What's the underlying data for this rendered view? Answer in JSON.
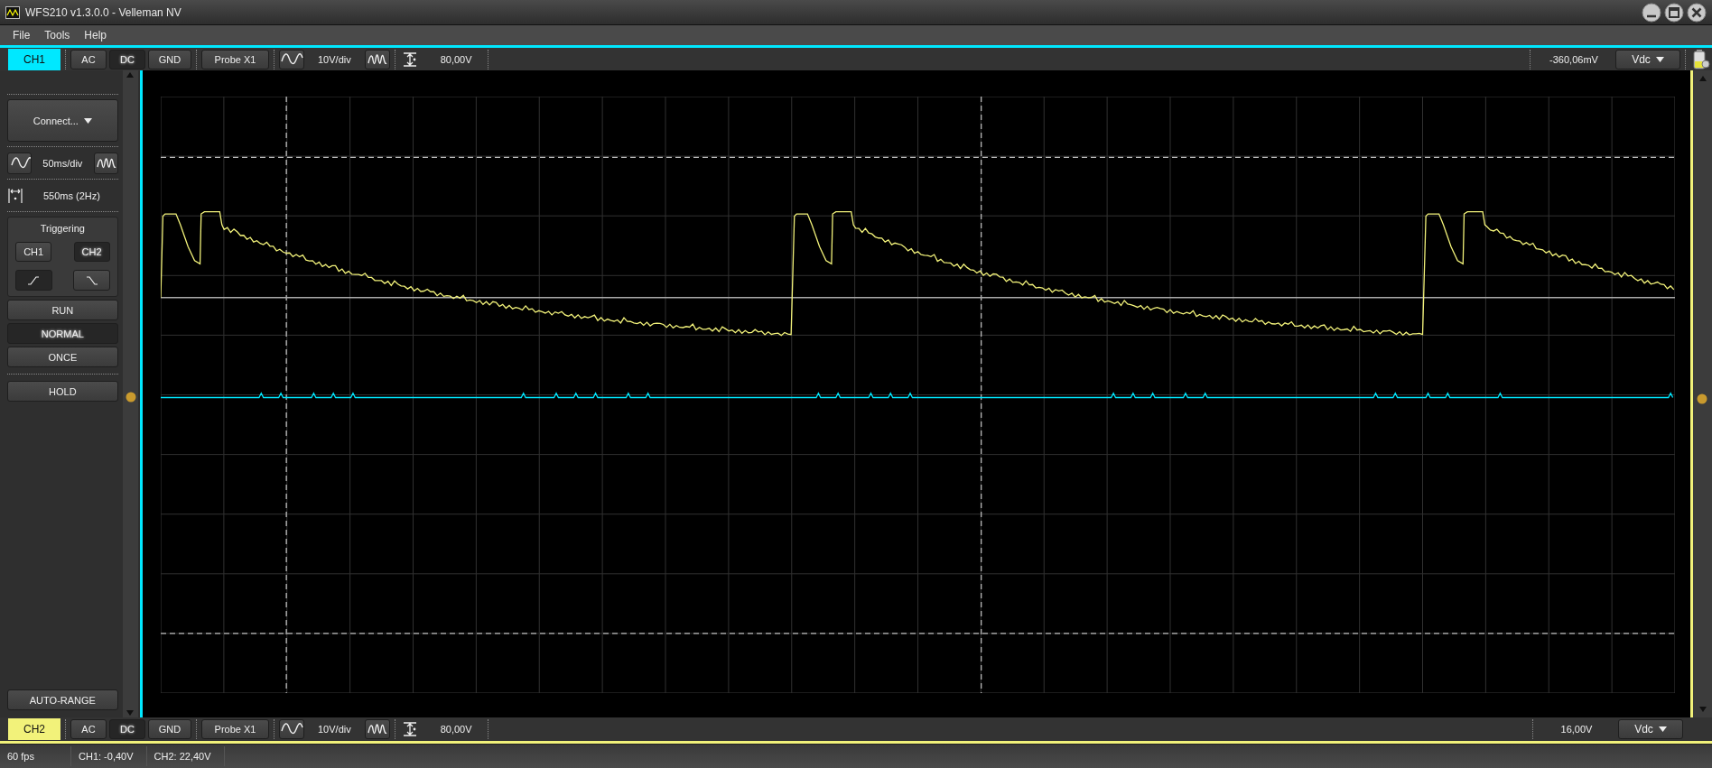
{
  "window": {
    "title": "WFS210 v1.3.0.0 - Velleman NV"
  },
  "menu": [
    "File",
    "Tools",
    "Help"
  ],
  "channels": [
    {
      "label": "CH1",
      "color": "#00e8ff",
      "coupling": [
        {
          "label": "AC",
          "selected": false
        },
        {
          "label": "DC",
          "selected": true
        },
        {
          "label": "GND",
          "selected": false
        }
      ],
      "probe": "Probe X1",
      "volts_per_div": "10V/div",
      "offset": "80,00V",
      "reading": "-360,06mV",
      "unit": "Vdc"
    },
    {
      "label": "CH2",
      "color": "#f2f27a",
      "coupling": [
        {
          "label": "AC",
          "selected": false
        },
        {
          "label": "DC",
          "selected": true
        },
        {
          "label": "GND",
          "selected": false
        }
      ],
      "probe": "Probe X1",
      "volts_per_div": "10V/div",
      "offset": "80,00V",
      "reading": "16,00V",
      "unit": "Vdc"
    }
  ],
  "side_panel": {
    "connect_button": "Connect...",
    "timebase": "50ms/div",
    "period": "550ms (2Hz)",
    "triggering": {
      "title": "Triggering",
      "sources": [
        {
          "label": "CH1",
          "selected": false
        },
        {
          "label": "CH2",
          "selected": true
        }
      ],
      "slopes": [
        {
          "kind": "rising",
          "selected": true
        },
        {
          "kind": "falling",
          "selected": false
        }
      ]
    },
    "modes": [
      {
        "label": "RUN",
        "selected": false
      },
      {
        "label": "NORMAL",
        "selected": true
      },
      {
        "label": "ONCE",
        "selected": false
      }
    ],
    "hold_button": "HOLD",
    "auto_range_button": "AUTO-RANGE"
  },
  "status_bar": [
    "60 fps",
    "CH1: -0,40V",
    "CH2: 22,40V"
  ]
}
